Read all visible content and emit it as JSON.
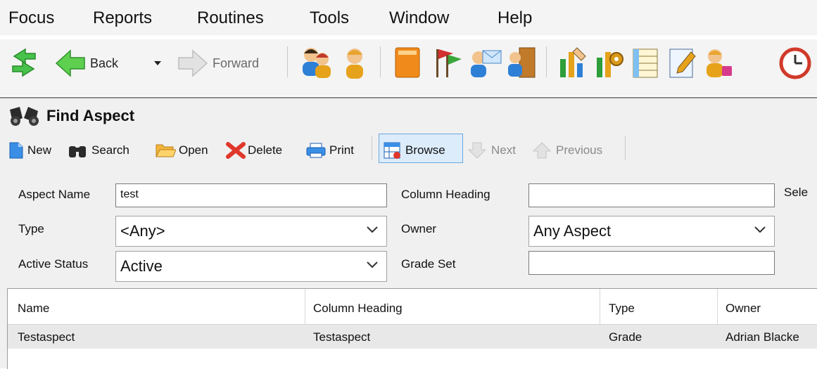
{
  "menubar": {
    "items": [
      {
        "label": "Focus"
      },
      {
        "label": "Reports"
      },
      {
        "label": "Routines"
      },
      {
        "label": "Tools"
      },
      {
        "label": "Window"
      },
      {
        "label": "Help"
      }
    ]
  },
  "toolbar": {
    "back_label": "Back",
    "forward_label": "Forward"
  },
  "panel": {
    "title": "Find Aspect",
    "toolbar": {
      "new": "New",
      "search": "Search",
      "open": "Open",
      "delete": "Delete",
      "print": "Print",
      "browse": "Browse",
      "next": "Next",
      "previous": "Previous"
    },
    "fields": {
      "aspect_name_label": "Aspect Name",
      "aspect_name_value": "test",
      "column_heading_label": "Column Heading",
      "column_heading_value": "",
      "select_label_partial": "Sele",
      "type_label": "Type",
      "type_value": "<Any>",
      "owner_label": "Owner",
      "owner_value": "Any Aspect",
      "active_status_label": "Active Status",
      "active_status_value": "Active",
      "grade_set_label": "Grade Set",
      "grade_set_value": ""
    }
  },
  "grid": {
    "columns": [
      "Name",
      "Column Heading",
      "Type",
      "Owner"
    ],
    "rows": [
      [
        "Testaspect",
        "Testaspect",
        "Grade",
        "Adrian Blacke"
      ]
    ]
  },
  "colors": {
    "selected_row": "#e8e8e8",
    "browse_highlight": "#dcecfb",
    "arrow_green": "#3bb13b"
  }
}
